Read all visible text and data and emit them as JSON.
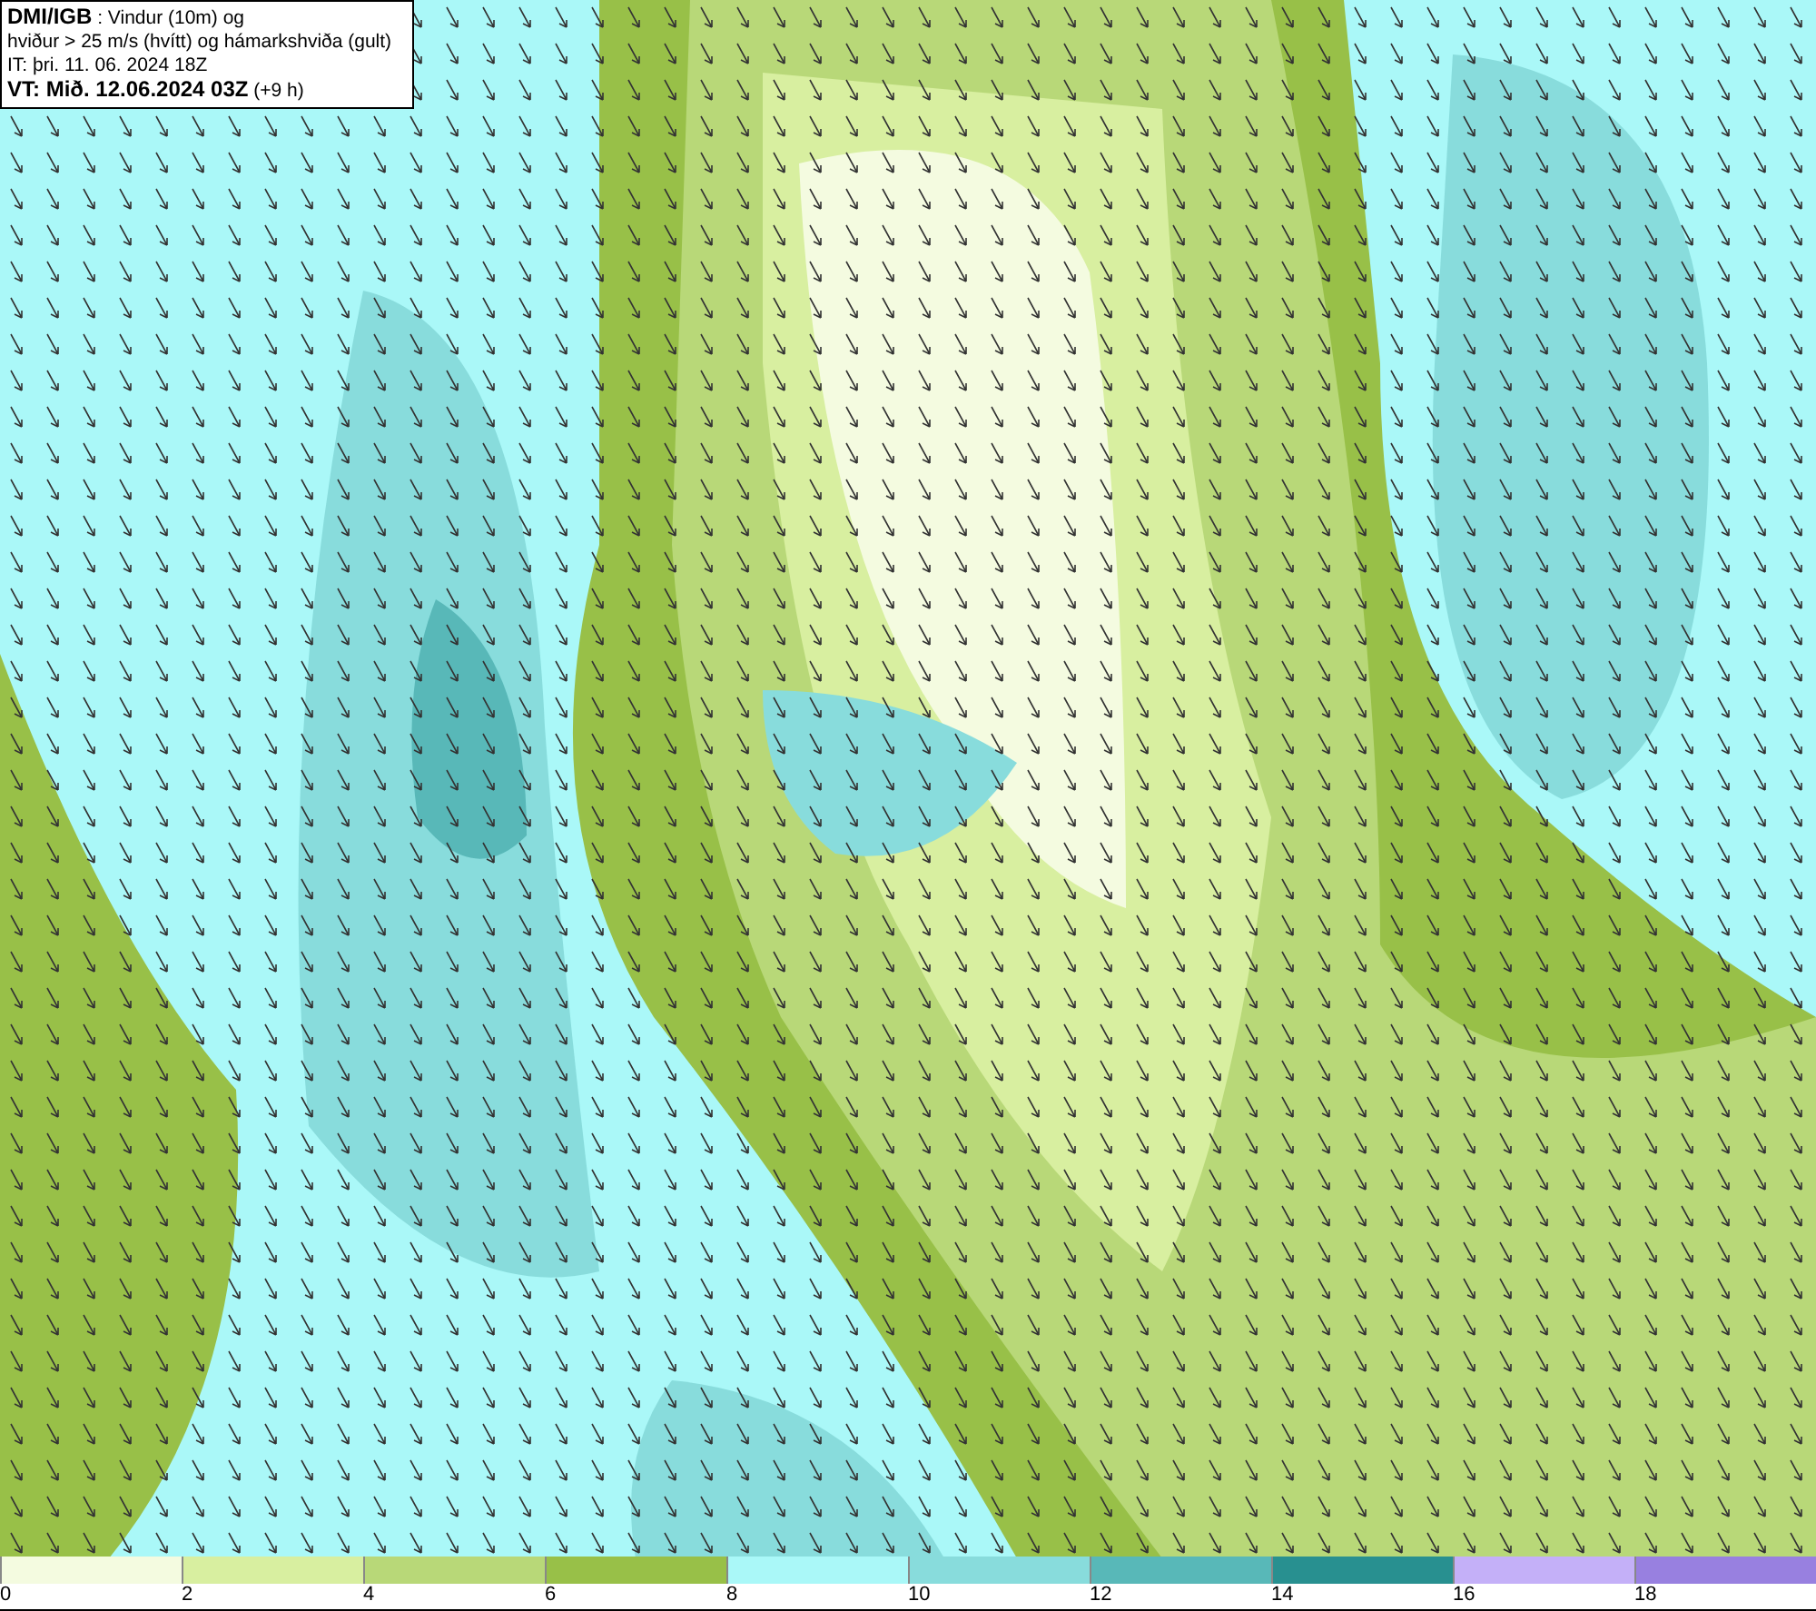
{
  "header": {
    "lines": [
      "**DMI/IGB** : Vindur (10m) og",
      "hviður > 25 m/s (hvítt) og hámarkshviða (gult)",
      "IT: þri. 11. 06. 2024 18Z",
      "**VT: Mið. 12.06.2024 03Z** (+9 h)"
    ]
  },
  "legend": [
    {
      "label": "0",
      "color": "#f4fbe0"
    },
    {
      "label": "2",
      "color": "#d8efa0"
    },
    {
      "label": "4",
      "color": "#b8d878"
    },
    {
      "label": "6",
      "color": "#98c048"
    },
    {
      "label": "8",
      "color": "#aaf8f8"
    },
    {
      "label": "10",
      "color": "#88dcdc"
    },
    {
      "label": "12",
      "color": "#58b8b8"
    },
    {
      "label": "14",
      "color": "#289090"
    },
    {
      "label": "16",
      "color": "#c4b0f8"
    },
    {
      "label": "18",
      "color": "#9880e0"
    }
  ]
}
